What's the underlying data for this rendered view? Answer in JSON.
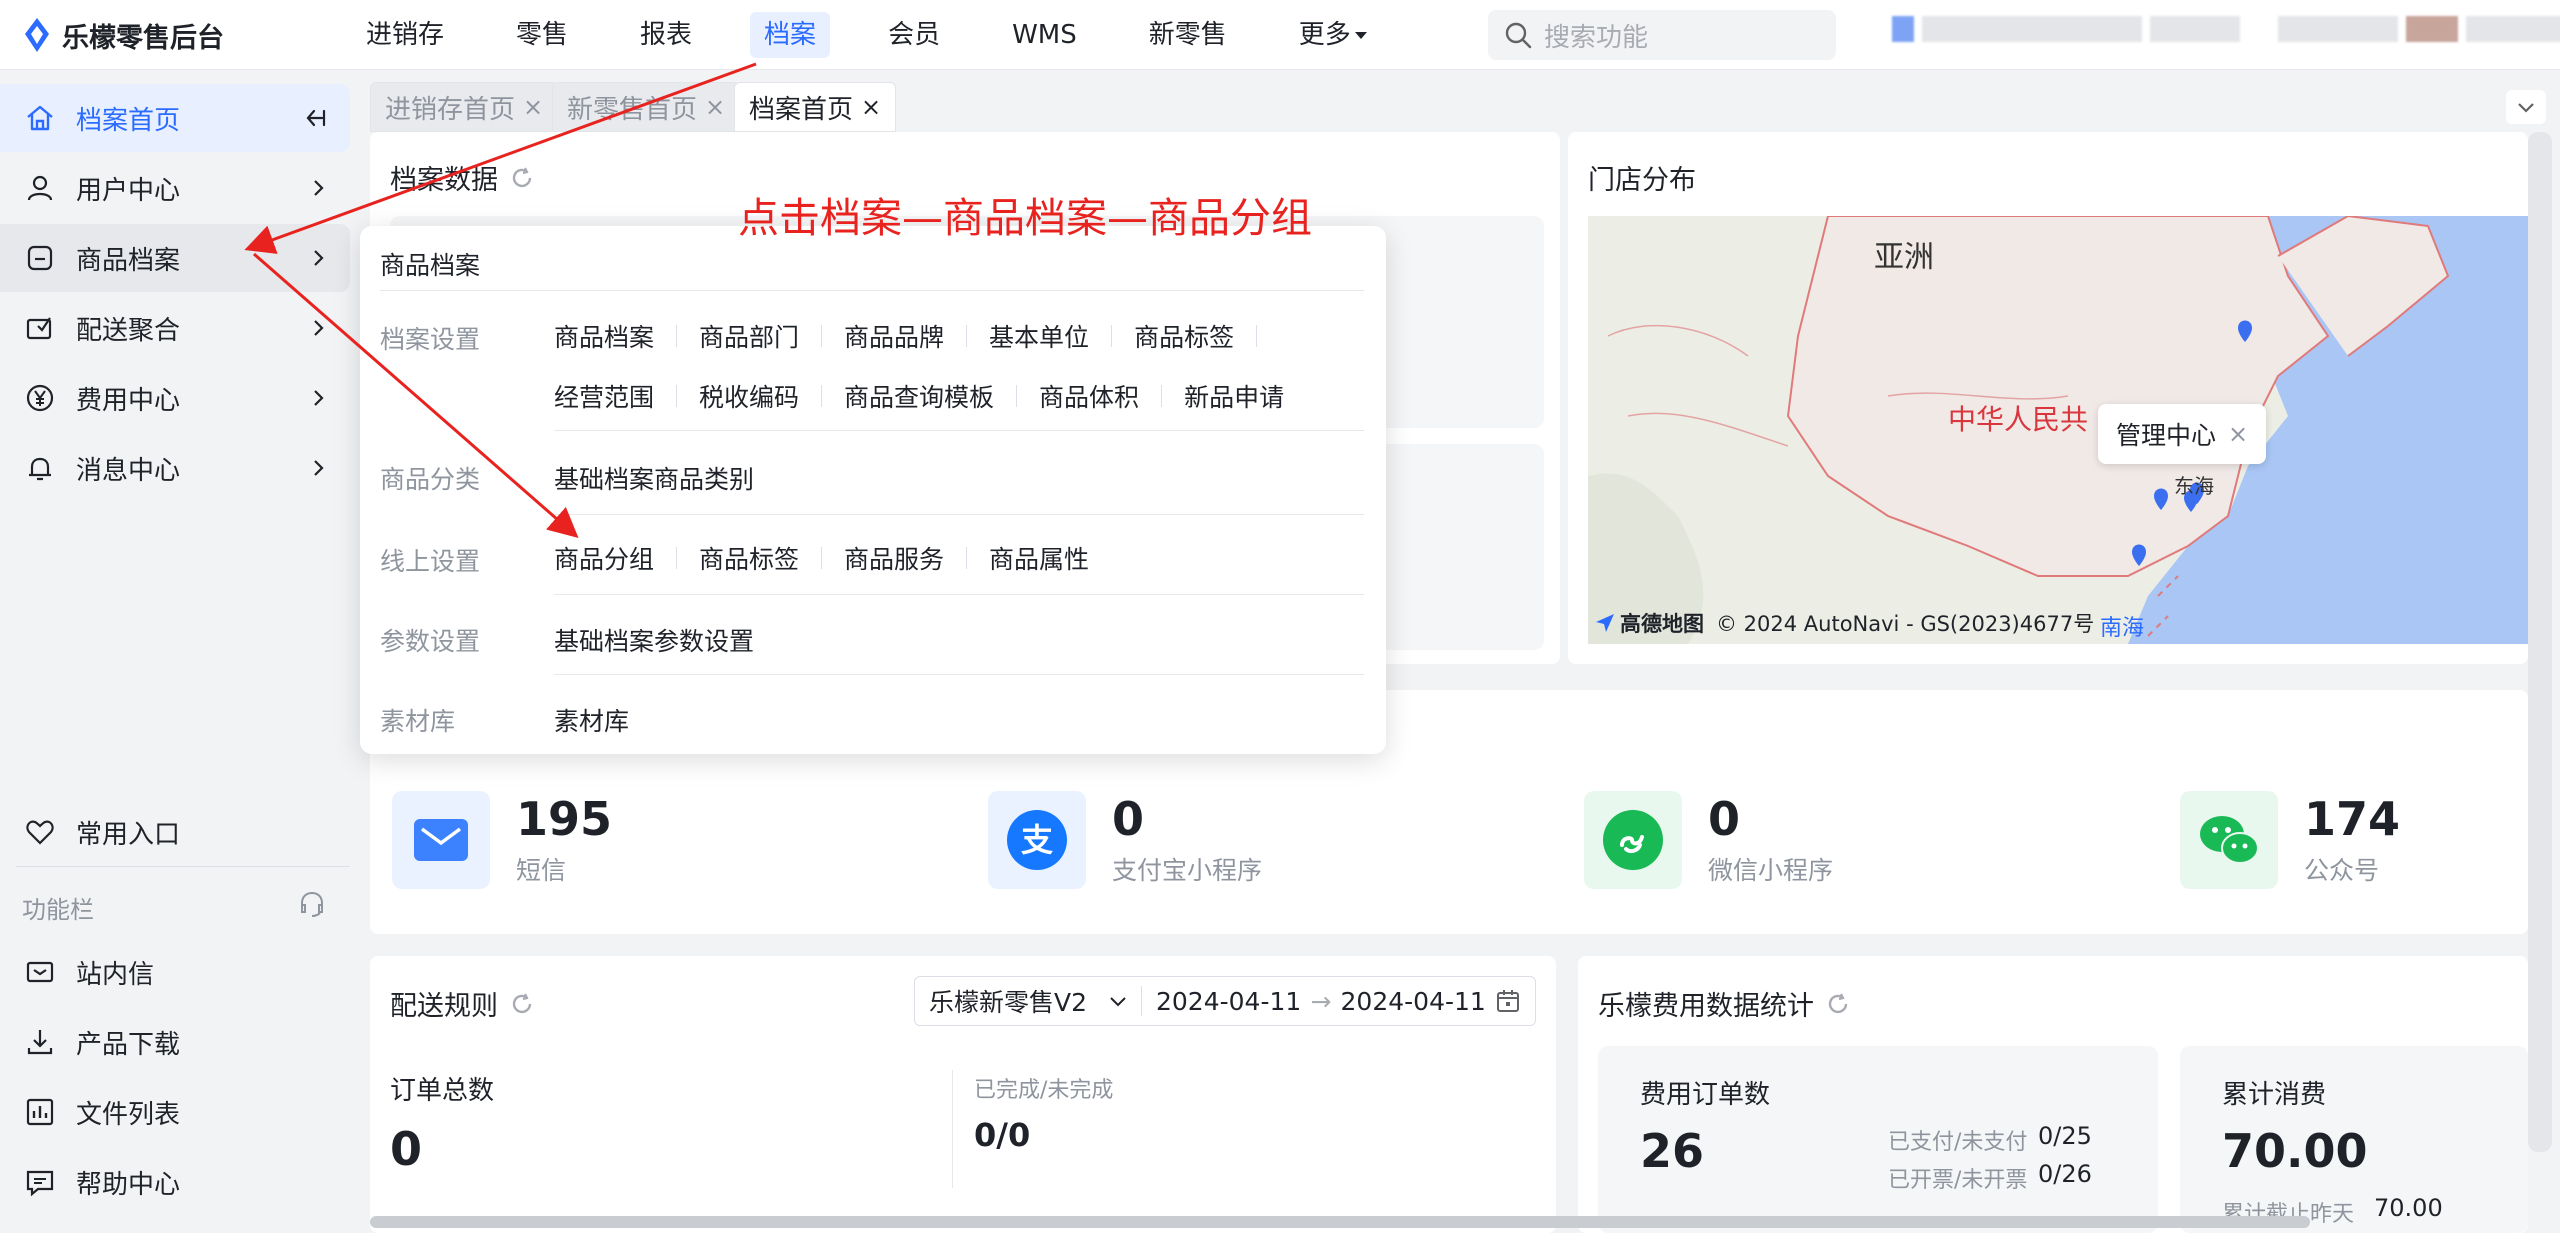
{
  "app": {
    "title": "乐檬零售后台"
  },
  "topnav": {
    "items": [
      "进销存",
      "零售",
      "报表",
      "档案",
      "会员",
      "WMS",
      "新零售",
      "更多"
    ],
    "active": "档案"
  },
  "search": {
    "placeholder": "搜索功能"
  },
  "sidebar": {
    "items": [
      {
        "label": "档案首页",
        "icon": "home-icon"
      },
      {
        "label": "用户中心",
        "icon": "user-icon"
      },
      {
        "label": "商品档案",
        "icon": "product-icon"
      },
      {
        "label": "配送聚合",
        "icon": "delivery-icon"
      },
      {
        "label": "费用中心",
        "icon": "yen-icon"
      },
      {
        "label": "消息中心",
        "icon": "bell-icon"
      }
    ],
    "common_entry": "常用入口",
    "function_bar": "功能栏",
    "bottom_items": [
      {
        "label": "站内信",
        "icon": "mail-icon"
      },
      {
        "label": "产品下载",
        "icon": "download-icon"
      },
      {
        "label": "文件列表",
        "icon": "chart-icon"
      },
      {
        "label": "帮助中心",
        "icon": "help-icon"
      }
    ]
  },
  "tabs": [
    {
      "label": "进销存首页",
      "close": "×"
    },
    {
      "label": "新零售首页",
      "close": "×"
    },
    {
      "label": "档案首页",
      "close": "×"
    }
  ],
  "archive_data": {
    "title": "档案数据"
  },
  "store_distribution": {
    "title": "门店分布",
    "map_labels": {
      "asia": "亚洲",
      "china": "中华人民共",
      "east_sea": "东海",
      "south_sea": "南海"
    },
    "tooltip": "管理中心",
    "tooltip_close": "×",
    "credit_logo": "高德地图",
    "credit": "© 2024 AutoNavi - GS(2023)4677号"
  },
  "stats": [
    {
      "value": "195",
      "label": "短信",
      "icon": "mail-icon",
      "color": "#3c82ff",
      "bg": "#eaf2ff"
    },
    {
      "value": "0",
      "label": "支付宝小程序",
      "icon": "alipay-icon",
      "color": "#1677ff",
      "bg": "#eaf2ff"
    },
    {
      "value": "0",
      "label": "微信小程序",
      "icon": "mini-program-icon",
      "color": "#19b955",
      "bg": "#e9f8ef"
    },
    {
      "value": "174",
      "label": "公众号",
      "icon": "wechat-icon",
      "color": "#19b955",
      "bg": "#e9f8ef"
    }
  ],
  "delivery": {
    "title": "配送规则",
    "select_value": "乐檬新零售V2",
    "date_start": "2024-04-11",
    "date_sep": "→",
    "date_end": "2024-04-11",
    "order_total_label": "订单总数",
    "order_total_value": "0",
    "completed_label": "已完成/未完成",
    "completed_value": "0/0"
  },
  "expense": {
    "title": "乐檬费用数据统计",
    "order_count_label": "费用订单数",
    "order_count_value": "26",
    "paid_label": "已支付/未支付",
    "paid_value": "0/25",
    "invoiced_label": "已开票/未开票",
    "invoiced_value": "0/26",
    "total_label": "累计消费",
    "total_value": "70.00",
    "yesterday_label": "累计截止昨天",
    "yesterday_value": "70.00"
  },
  "dropdown": {
    "title": "商品档案",
    "sections": [
      {
        "category": "档案设置",
        "rows": [
          [
            "商品档案",
            "商品部门",
            "商品品牌",
            "基本单位",
            "商品标签"
          ],
          [
            "经营范围",
            "税收编码",
            "商品查询模板",
            "商品体积",
            "新品申请"
          ]
        ]
      },
      {
        "category": "商品分类",
        "rows": [
          [
            "基础档案商品类别"
          ]
        ]
      },
      {
        "category": "线上设置",
        "rows": [
          [
            "商品分组",
            "商品标签",
            "商品服务",
            "商品属性"
          ]
        ]
      },
      {
        "category": "参数设置",
        "rows": [
          [
            "基础档案参数设置"
          ]
        ]
      },
      {
        "category": "素材库",
        "rows": [
          [
            "素材库"
          ]
        ]
      }
    ]
  },
  "annotation": {
    "text": "点击档案—商品档案—商品分组",
    "color": "#e8231f"
  },
  "colors": {
    "accent": "#2b6bff",
    "annotation": "#e8231f"
  }
}
